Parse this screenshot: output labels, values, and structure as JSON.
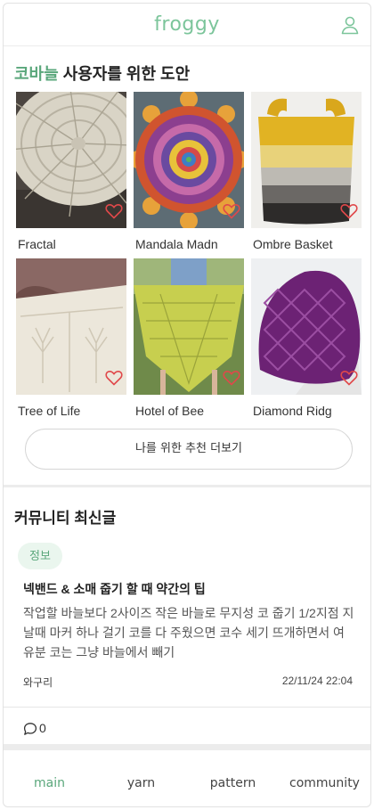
{
  "app": {
    "logo": "froggy",
    "user_icon": "user-icon"
  },
  "recommend": {
    "title_accent": "코바늘",
    "title_rest": " 사용자를 위한 도안",
    "patterns": [
      {
        "name": "Fractal",
        "liked": false
      },
      {
        "name": "Mandala Madn",
        "liked": false
      },
      {
        "name": "Ombre Basket",
        "liked": false
      },
      {
        "name": "Tree of Life",
        "liked": false
      },
      {
        "name": "Hotel of Bee",
        "liked": false
      },
      {
        "name": "Diamond Ridg",
        "liked": false
      }
    ],
    "more_button": "나를 위한 추천 더보기"
  },
  "community": {
    "title": "커뮤니티 최신글",
    "post": {
      "tag": "정보",
      "title": "넥밴드 & 소매 줍기 할 때 약간의 팁",
      "body": "작업할 바늘보다 2사이즈 작은 바늘로 무지성 코 줍기 1/2지점 지날때 마커 하나 걸기 코를 다 주웠으면 코수 세기 뜨개하면서 여유분 코는 그냥 바늘에서 빼기",
      "author": "와구리",
      "date": "22/11/24 22:04",
      "comment_count": "0"
    }
  },
  "nav": {
    "items": [
      {
        "label": "main",
        "active": true
      },
      {
        "label": "yarn",
        "active": false
      },
      {
        "label": "pattern",
        "active": false
      },
      {
        "label": "community",
        "active": false
      }
    ]
  },
  "colors": {
    "brand": "#7cc59b",
    "accent": "#5aa77b",
    "heart": "#e0484a"
  }
}
